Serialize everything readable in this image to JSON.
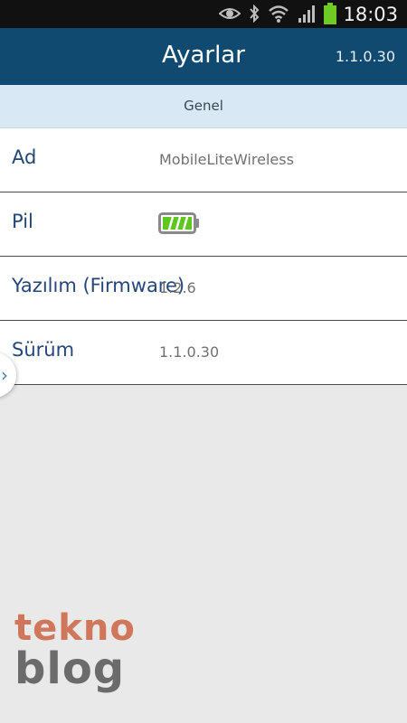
{
  "status_bar": {
    "time": "18:03",
    "icons": [
      "eye-icon",
      "bluetooth-icon",
      "wifi-icon",
      "signal-icon",
      "battery-icon"
    ]
  },
  "header": {
    "title": "Ayarlar",
    "version": "1.1.0.30"
  },
  "section": {
    "title": "Genel"
  },
  "settings": [
    {
      "label": "Ad",
      "value": "MobileLiteWireless"
    },
    {
      "label": "Pil",
      "value_icon": "battery-full-icon",
      "battery_level": 1.0
    },
    {
      "label": "Yazılım (Firmware)",
      "value": "1.2.6"
    },
    {
      "label": "Sürüm",
      "value": "1.1.0.30"
    }
  ],
  "side_tab": {
    "icon": "chevron-right-icon"
  },
  "watermark": {
    "line1": "tekno",
    "line2": "blog"
  },
  "colors": {
    "app_bar": "#114a70",
    "section_header": "#d8e9f5",
    "label": "#24467a",
    "battery_green": "#5fc51f",
    "watermark_orange": "#d0765a",
    "watermark_gray": "#6b6b6b"
  }
}
